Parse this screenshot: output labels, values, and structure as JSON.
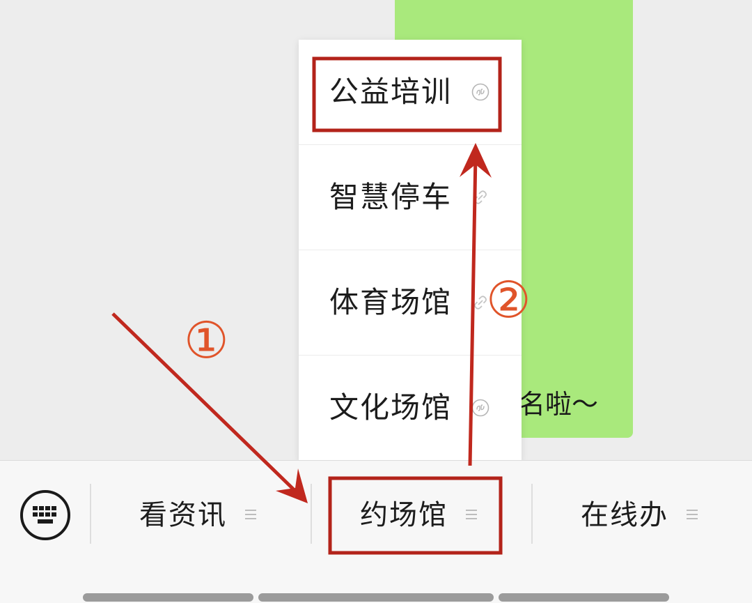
{
  "chat": {
    "bubble_text": "名啦～",
    "bubble_color": "#a9e97c"
  },
  "popup_menu": {
    "items": [
      {
        "label": "公益培训",
        "icon": "mini-program-icon"
      },
      {
        "label": "智慧停车",
        "icon": "link-icon"
      },
      {
        "label": "体育场馆",
        "icon": "link-icon"
      },
      {
        "label": "文化场馆",
        "icon": "mini-program-icon"
      }
    ]
  },
  "menu_bar": {
    "keyboard_icon": "keyboard-icon",
    "items": [
      {
        "label": "看资讯",
        "icon": "menu-lines-icon"
      },
      {
        "label": "约场馆",
        "icon": "menu-lines-icon"
      },
      {
        "label": "在线办",
        "icon": "menu-lines-icon"
      }
    ]
  },
  "annotations": {
    "step1": "①",
    "step2": "②",
    "highlight_color": "#b3231a",
    "arrow_color": "#c0281e",
    "number_color": "#e0542a"
  }
}
